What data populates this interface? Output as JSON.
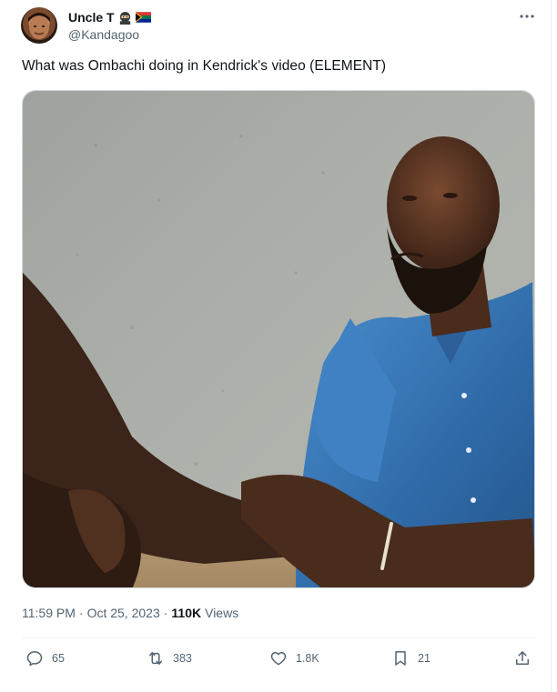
{
  "author": {
    "display_name": "Uncle T",
    "handle": "@Kandagoo",
    "emoji_icons": [
      "ninja-icon",
      "south-africa-flag-icon"
    ]
  },
  "more_icon": "more-horizontal-icon",
  "tweet": {
    "text": "What was Ombachi doing in Kendrick's video (ELEMENT)"
  },
  "meta": {
    "time": "11:59 PM",
    "separator": "·",
    "date": "Oct 25, 2023",
    "separator2": "·",
    "views_count": "110K",
    "views_label": "Views"
  },
  "actions": {
    "replies": "65",
    "retweets": "383",
    "likes": "1.8K",
    "bookmarks": "21"
  },
  "colors": {
    "text_primary": "#0f1419",
    "text_secondary": "#536471",
    "shirt": "#3a78b6",
    "wall": "#a7aba6"
  }
}
